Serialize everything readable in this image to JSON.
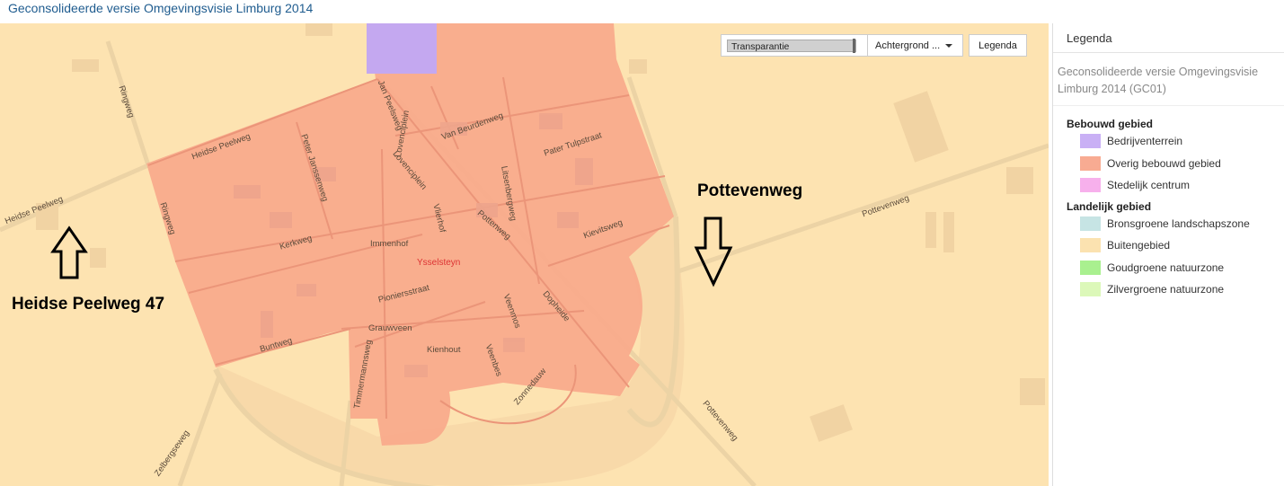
{
  "page": {
    "title": "Geconsolideerde versie Omgevingsvisie Limburg 2014"
  },
  "controls": {
    "transparency_label": "Transparantie",
    "background_label": "Achtergrond ...",
    "legend_button": "Legenda"
  },
  "map": {
    "annotations": {
      "pottevenweg": "Pottevenweg",
      "heidse": "Heidse Peelweg 47"
    },
    "place_name": "Ysselsteyn",
    "streets": {
      "heidse_peelweg_1": "Heidse Peelweg",
      "heidse_peelweg_2": "Heidse Peelweg",
      "ringweg_1": "Ringweg",
      "ringweg_2": "Ringweg",
      "peter_janssenweg": "Peter Janssenweg",
      "jan_peelsweg": "Jan Peelsweg",
      "van_beurdenweg": "Van Beurdenweg",
      "pater_tulpstraat": "Pater Tulpstraat",
      "lovenciplein_1": "Lovenciplein",
      "lovenciplein_2": "Lovenciplein",
      "litsenbergweg": "Litsenbergweg",
      "kerkweg": "Kerkweg",
      "immenhof": "Immenhof",
      "vlierhof": "Vlierhof",
      "pottenweg": "Pottenweg",
      "kievitsweg": "Kievitsweg",
      "pottevenweg_map": "Pottevenweg",
      "pottevenweg_map_2": "Pottevenweg",
      "pioniersstraat": "Pioniersstraat",
      "grauwveen": "Grauwveen",
      "veenmos": "Veenmos",
      "dopheide": "Dopheide",
      "buntweg": "Buntweg",
      "kienhout": "Kienhout",
      "veenbes": "Veenbes",
      "zonnedauw": "Zonnedauw",
      "timmermannsweg": "Timmermannsweg",
      "zelbergseweg": "Zelbergseweg"
    },
    "colors": {
      "buitengebied": "#fde3b1",
      "overig_bebouwd": "#f9a98b",
      "bedrijventerrein": "#c4a8f0",
      "roads": "#ecd3a5"
    }
  },
  "legend": {
    "title": "Legenda",
    "subtitle": "Geconsolideerde versie Omgevingsvisie Limburg 2014 (GC01)",
    "groups": [
      {
        "name": "Bebouwd gebied",
        "items": [
          {
            "label": "Bedrijventerrein",
            "color": "#c9b0f5"
          },
          {
            "label": "Overig bebouwd gebied",
            "color": "#f8ab92"
          },
          {
            "label": "Stedelijk centrum",
            "color": "#f7b0ec"
          }
        ]
      },
      {
        "name": "Landelijk gebied",
        "items": [
          {
            "label": "Bronsgroene landschapszone",
            "color": "#c6e4e4"
          },
          {
            "label": "Buitengebied",
            "color": "#fbe2b0"
          },
          {
            "label": "Goudgroene natuurzone",
            "color": "#a9f08f"
          },
          {
            "label": "Zilvergroene natuurzone",
            "color": "#dcf8b9"
          }
        ]
      }
    ]
  }
}
